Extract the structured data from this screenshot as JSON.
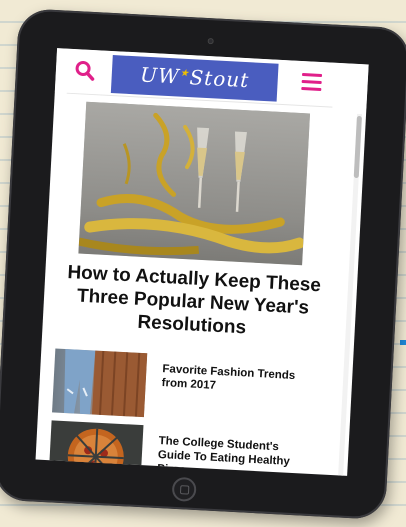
{
  "header": {
    "logo_text": "UW",
    "logo_text_2": "Stout",
    "brand_color": "#4a5dbf",
    "accent_color": "#e0208a",
    "search_icon": "search-icon",
    "menu_icon": "hamburger-menu-icon"
  },
  "featured": {
    "headline": "How to Actually Keep These Three Popular New Year's Resolutions"
  },
  "articles": [
    {
      "title": "Favorite Fashion Trends from 2017"
    },
    {
      "title": "The College Student's Guide To Eating Healthy Pizza"
    }
  ]
}
